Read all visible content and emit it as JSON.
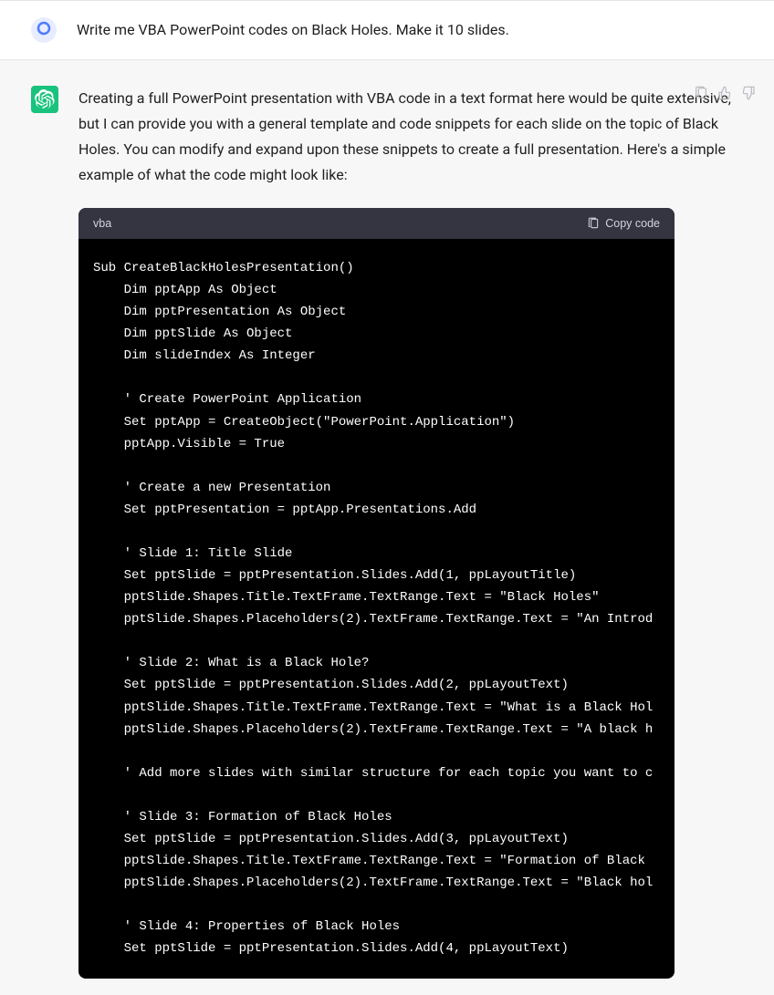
{
  "user_message": "Write me VBA PowerPoint codes on Black Holes. Make it 10 slides.",
  "assistant_intro": "Creating a full PowerPoint presentation with VBA code in a text format here would be quite extensive, but I can provide you with a general template and code snippets for each slide on the topic of Black Holes. You can modify and expand upon these snippets to create a full presentation. Here's a simple example of what the code might look like:",
  "code_lang": "vba",
  "copy_label": "Copy code",
  "code_lines": [
    "Sub CreateBlackHolesPresentation()",
    "    Dim pptApp As Object",
    "    Dim pptPresentation As Object",
    "    Dim pptSlide As Object",
    "    Dim slideIndex As Integer",
    "",
    "    ' Create PowerPoint Application",
    "    Set pptApp = CreateObject(\"PowerPoint.Application\")",
    "    pptApp.Visible = True",
    "",
    "    ' Create a new Presentation",
    "    Set pptPresentation = pptApp.Presentations.Add",
    "",
    "    ' Slide 1: Title Slide",
    "    Set pptSlide = pptPresentation.Slides.Add(1, ppLayoutTitle)",
    "    pptSlide.Shapes.Title.TextFrame.TextRange.Text = \"Black Holes\"",
    "    pptSlide.Shapes.Placeholders(2).TextFrame.TextRange.Text = \"An Introd",
    "",
    "    ' Slide 2: What is a Black Hole?",
    "    Set pptSlide = pptPresentation.Slides.Add(2, ppLayoutText)",
    "    pptSlide.Shapes.Title.TextFrame.TextRange.Text = \"What is a Black Hol",
    "    pptSlide.Shapes.Placeholders(2).TextFrame.TextRange.Text = \"A black h",
    "",
    "    ' Add more slides with similar structure for each topic you want to c",
    "",
    "    ' Slide 3: Formation of Black Holes",
    "    Set pptSlide = pptPresentation.Slides.Add(3, ppLayoutText)",
    "    pptSlide.Shapes.Title.TextFrame.TextRange.Text = \"Formation of Black ",
    "    pptSlide.Shapes.Placeholders(2).TextFrame.TextRange.Text = \"Black hol",
    "",
    "    ' Slide 4: Properties of Black Holes",
    "    Set pptSlide = pptPresentation.Slides.Add(4, ppLayoutText)"
  ]
}
